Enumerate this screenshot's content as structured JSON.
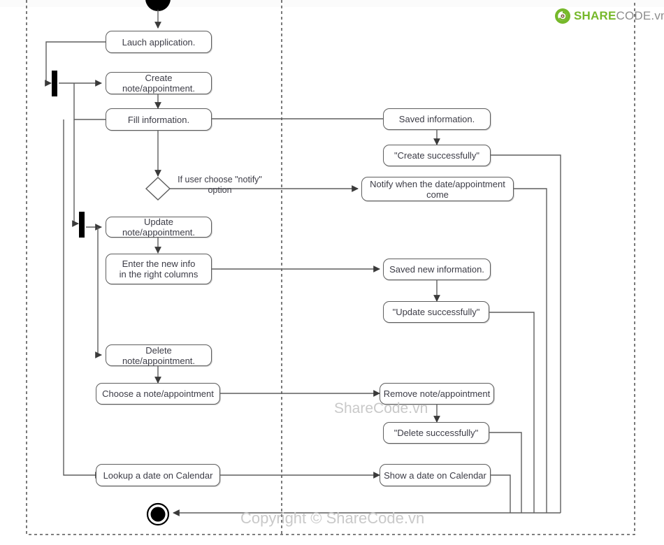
{
  "logo": {
    "mark": "recycle-circle-icon",
    "primary_text": "SHARE",
    "secondary_text": "CODE.vn",
    "primary_color": "#76b82a",
    "secondary_color": "#8c8c8c"
  },
  "watermarks": {
    "middle": "ShareCode.vn",
    "bottom": "Copyright © ShareCode.vn"
  },
  "diagram": {
    "type": "uml-activity-diagram",
    "stroke_color": "#5e5e5e",
    "frame_color": "#333333",
    "nodes": {
      "start": "start-node",
      "end": "end-node",
      "decision": "decision-diamond",
      "fork_top": "fork-bar-top",
      "fork_mid": "fork-bar-middle"
    },
    "activities": [
      {
        "id": "launch",
        "label": "Lauch application."
      },
      {
        "id": "create",
        "label": "Create note/appointment."
      },
      {
        "id": "fill",
        "label": "Fill information."
      },
      {
        "id": "saved_info",
        "label": "Saved information."
      },
      {
        "id": "create_ok",
        "label": "\"Create successfully\""
      },
      {
        "id": "notify",
        "label": "Notify when the date/appointment come"
      },
      {
        "id": "update",
        "label": "Update note/appointment."
      },
      {
        "id": "enter_new",
        "label": "Enter the new info\nin the right columns"
      },
      {
        "id": "saved_new",
        "label": "Saved new information."
      },
      {
        "id": "update_ok",
        "label": "\"Update successfully\""
      },
      {
        "id": "delete",
        "label": "Delete note/appointment."
      },
      {
        "id": "choose",
        "label": "Choose a note/appointment"
      },
      {
        "id": "remove",
        "label": "Remove note/appointment"
      },
      {
        "id": "delete_ok",
        "label": "\"Delete successfully\""
      },
      {
        "id": "lookup",
        "label": "Lookup a date on Calendar"
      },
      {
        "id": "show_date",
        "label": "Show a date on Calendar"
      }
    ],
    "edge_labels": [
      {
        "id": "notify_guard",
        "label": "If user choose \"notify\"\noption"
      }
    ]
  }
}
